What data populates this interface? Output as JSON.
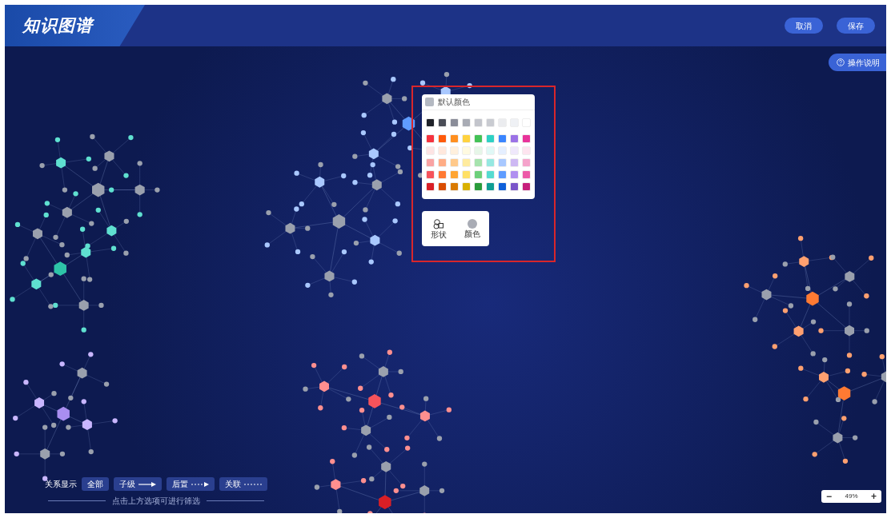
{
  "header": {
    "title": "知识图谱",
    "buttons": [
      "取消",
      "保存"
    ]
  },
  "help_button": {
    "label": "操作说明"
  },
  "color_popup": {
    "default_label": "默认颜色",
    "default_swatch": {
      "color": "#b4b9c2"
    },
    "swatch_rows": [
      [
        {
          "color": "#1f2229"
        },
        {
          "color": "#4a4d57"
        },
        {
          "color": "#8a8d99"
        },
        {
          "color": "#a9acb5"
        },
        {
          "color": "#c3c5cc"
        },
        {
          "color": "#c9cbd1"
        },
        {
          "color": "#ebecef"
        },
        {
          "color": "#eff1f5"
        },
        {
          "color": "#ffffff"
        }
      ],
      [
        {
          "color": "#f5333f"
        },
        {
          "color": "#ff5a0a"
        },
        {
          "color": "#ff8f1f"
        },
        {
          "color": "#ffd23f"
        },
        {
          "color": "#43c256"
        },
        {
          "color": "#2ed1c4"
        },
        {
          "color": "#3a85ff"
        },
        {
          "color": "#9b72e6"
        },
        {
          "color": "#e8339a"
        }
      ],
      [
        {
          "color": "#fde4e4"
        },
        {
          "color": "#ffe8dd"
        },
        {
          "color": "#fff0dd"
        },
        {
          "color": "#fffae0"
        },
        {
          "color": "#e6f6e8"
        },
        {
          "color": "#e0f8f6"
        },
        {
          "color": "#e5efff"
        },
        {
          "color": "#efe8fb"
        },
        {
          "color": "#fde4ef"
        }
      ],
      [
        {
          "color": "#f9a3a3"
        },
        {
          "color": "#ffad86"
        },
        {
          "color": "#ffc98a"
        },
        {
          "color": "#ffeb9e"
        },
        {
          "color": "#a6e3ae"
        },
        {
          "color": "#96e8e1"
        },
        {
          "color": "#a8c8ff"
        },
        {
          "color": "#cdb8f3"
        },
        {
          "color": "#f5a3cb"
        }
      ],
      [
        {
          "color": "#f5535b"
        },
        {
          "color": "#ff7a33"
        },
        {
          "color": "#ffa532"
        },
        {
          "color": "#ffe066"
        },
        {
          "color": "#6ccf7a"
        },
        {
          "color": "#55dbd0"
        },
        {
          "color": "#5f9cff"
        },
        {
          "color": "#b08ff0"
        },
        {
          "color": "#ed5aa8"
        }
      ],
      [
        {
          "color": "#d91f26"
        },
        {
          "color": "#d94d00"
        },
        {
          "color": "#d97a00"
        },
        {
          "color": "#d9b100"
        },
        {
          "color": "#2a9c3b"
        },
        {
          "color": "#0f9e94"
        },
        {
          "color": "#0f5fd9"
        },
        {
          "color": "#7a55c9"
        },
        {
          "color": "#c71f7c"
        }
      ]
    ]
  },
  "style_tabs": [
    {
      "kind": "shape",
      "label": "形状"
    },
    {
      "kind": "color",
      "label": "颜色"
    }
  ],
  "relation_filter": {
    "label": "关系显示",
    "options": [
      {
        "kind": "all",
        "label": "全部"
      },
      {
        "kind": "solid-arrow",
        "label": "子级"
      },
      {
        "kind": "dotted-arrow",
        "label": "后置"
      },
      {
        "kind": "dotted",
        "label": "关联"
      }
    ],
    "hint": "点击上方选项可进行筛选"
  },
  "zoom": {
    "minus": "−",
    "value": "49%",
    "plus": "+"
  }
}
